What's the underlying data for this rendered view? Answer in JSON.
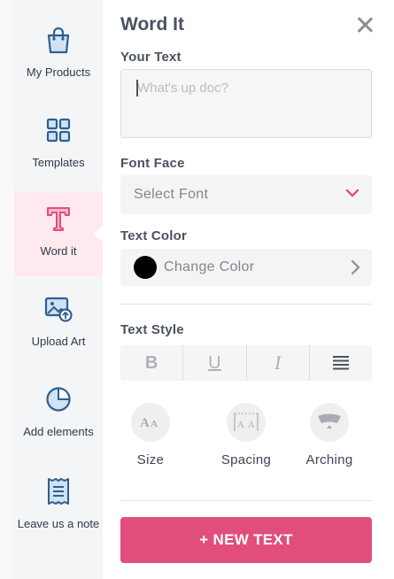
{
  "sidebar": {
    "items": [
      {
        "label": "My Products",
        "icon": "shopping-bag-icon"
      },
      {
        "label": "Templates",
        "icon": "grid-icon"
      },
      {
        "label": "Word it",
        "icon": "text-t-icon",
        "active": true
      },
      {
        "label": "Upload Art",
        "icon": "image-upload-icon"
      },
      {
        "label": "Add elements",
        "icon": "shape-icon"
      },
      {
        "label": "Leave us a note",
        "icon": "note-icon"
      }
    ]
  },
  "panel": {
    "title": "Word It",
    "your_text_label": "Your Text",
    "text_placeholder": "What's up doc?",
    "text_value": "",
    "font_face_label": "Font Face",
    "font_select_text": "Select Font",
    "text_color_label": "Text Color",
    "color_value": "#000000",
    "change_color_text": "Change Color",
    "text_style_label": "Text Style",
    "style_buttons": [
      "B",
      "U",
      "I",
      "align-justify"
    ],
    "tools": [
      {
        "label": "Size",
        "icon": "font-size-icon"
      },
      {
        "label": "Spacing",
        "icon": "letter-spacing-icon"
      },
      {
        "label": "Arching",
        "icon": "arch-icon"
      }
    ],
    "new_text_button": "+ NEW TEXT"
  },
  "colors": {
    "accent": "#e24e7b",
    "icon_blue": "#2f5f8f",
    "active_bg": "#fde9ee"
  }
}
